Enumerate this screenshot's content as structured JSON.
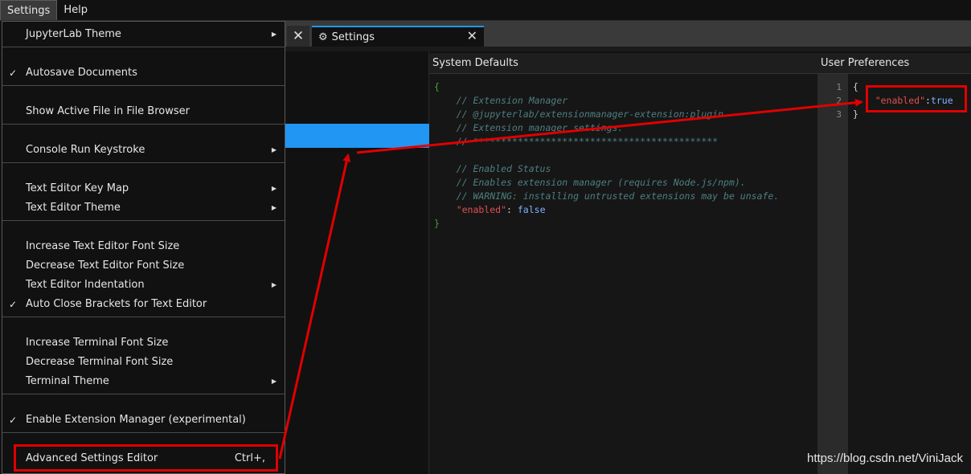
{
  "menubar": {
    "items": [
      {
        "label": "Settings"
      },
      {
        "label": "Help"
      }
    ]
  },
  "tabs": {
    "close_symbol": "✕",
    "active": {
      "label": "Settings",
      "icon": "gear-icon",
      "close_symbol": "✕"
    }
  },
  "settings_menu": {
    "items": [
      {
        "label": "JupyterLab Theme",
        "submenu": true
      },
      {
        "label": "Autosave Documents",
        "checked": true
      },
      {
        "label": "Show Active File in File Browser"
      },
      {
        "label": "Console Run Keystroke",
        "submenu": true
      },
      {
        "label": "Text Editor Key Map",
        "submenu": true
      },
      {
        "label": "Text Editor Theme",
        "submenu": true
      },
      {
        "label": "Increase Text Editor Font Size"
      },
      {
        "label": "Decrease Text Editor Font Size"
      },
      {
        "label": "Text Editor Indentation",
        "submenu": true
      },
      {
        "label": "Auto Close Brackets for Text Editor",
        "checked": true
      },
      {
        "label": "Increase Terminal Font Size"
      },
      {
        "label": "Decrease Terminal Font Size"
      },
      {
        "label": "Terminal Theme",
        "submenu": true
      },
      {
        "label": "Enable Extension Manager (experimental)",
        "checked": true
      },
      {
        "label": "Advanced Settings Editor",
        "shortcut": "Ctrl+,"
      }
    ],
    "check_symbol": "✓",
    "arrow_symbol": "▶"
  },
  "system_defaults": {
    "header": "System Defaults",
    "lines": [
      {
        "segments": [
          {
            "cls": "c-brace",
            "text": "{"
          }
        ]
      },
      {
        "segments": [
          {
            "cls": "c-comment",
            "text": "    // Extension Manager"
          }
        ]
      },
      {
        "segments": [
          {
            "cls": "c-comment",
            "text": "    // @jupyterlab/extensionmanager-extension:plugin"
          }
        ]
      },
      {
        "segments": [
          {
            "cls": "c-comment",
            "text": "    // Extension manager settings."
          }
        ]
      },
      {
        "segments": [
          {
            "cls": "c-comment",
            "text": "    // ********************************************"
          }
        ]
      },
      {
        "segments": []
      },
      {
        "segments": [
          {
            "cls": "c-comment",
            "text": "    // Enabled Status"
          }
        ]
      },
      {
        "segments": [
          {
            "cls": "c-comment",
            "text": "    // Enables extension manager (requires Node.js/npm)."
          }
        ]
      },
      {
        "segments": [
          {
            "cls": "c-comment",
            "text": "    // WARNING: installing untrusted extensions may be unsafe."
          }
        ]
      },
      {
        "segments": [
          {
            "cls": "c-key",
            "text": "    \"enabled\""
          },
          {
            "cls": "c-plain",
            "text": ": "
          },
          {
            "cls": "c-val",
            "text": "false"
          }
        ]
      },
      {
        "segments": [
          {
            "cls": "c-brace",
            "text": "}"
          }
        ]
      }
    ]
  },
  "user_preferences": {
    "header": "User Preferences",
    "line_numbers": [
      "1",
      "2",
      "3"
    ],
    "lines": [
      {
        "segments": [
          {
            "cls": "c-plain",
            "text": "{"
          }
        ]
      },
      {
        "segments": [
          {
            "cls": "c-key",
            "text": "    \"enabled\""
          },
          {
            "cls": "c-plain",
            "text": ":"
          },
          {
            "cls": "c-val",
            "text": "true"
          }
        ]
      },
      {
        "segments": [
          {
            "cls": "c-plain",
            "text": "}"
          }
        ]
      }
    ]
  },
  "annotations": {
    "color": "#e00000"
  },
  "watermark": "https://blog.csdn.net/ViniJack"
}
